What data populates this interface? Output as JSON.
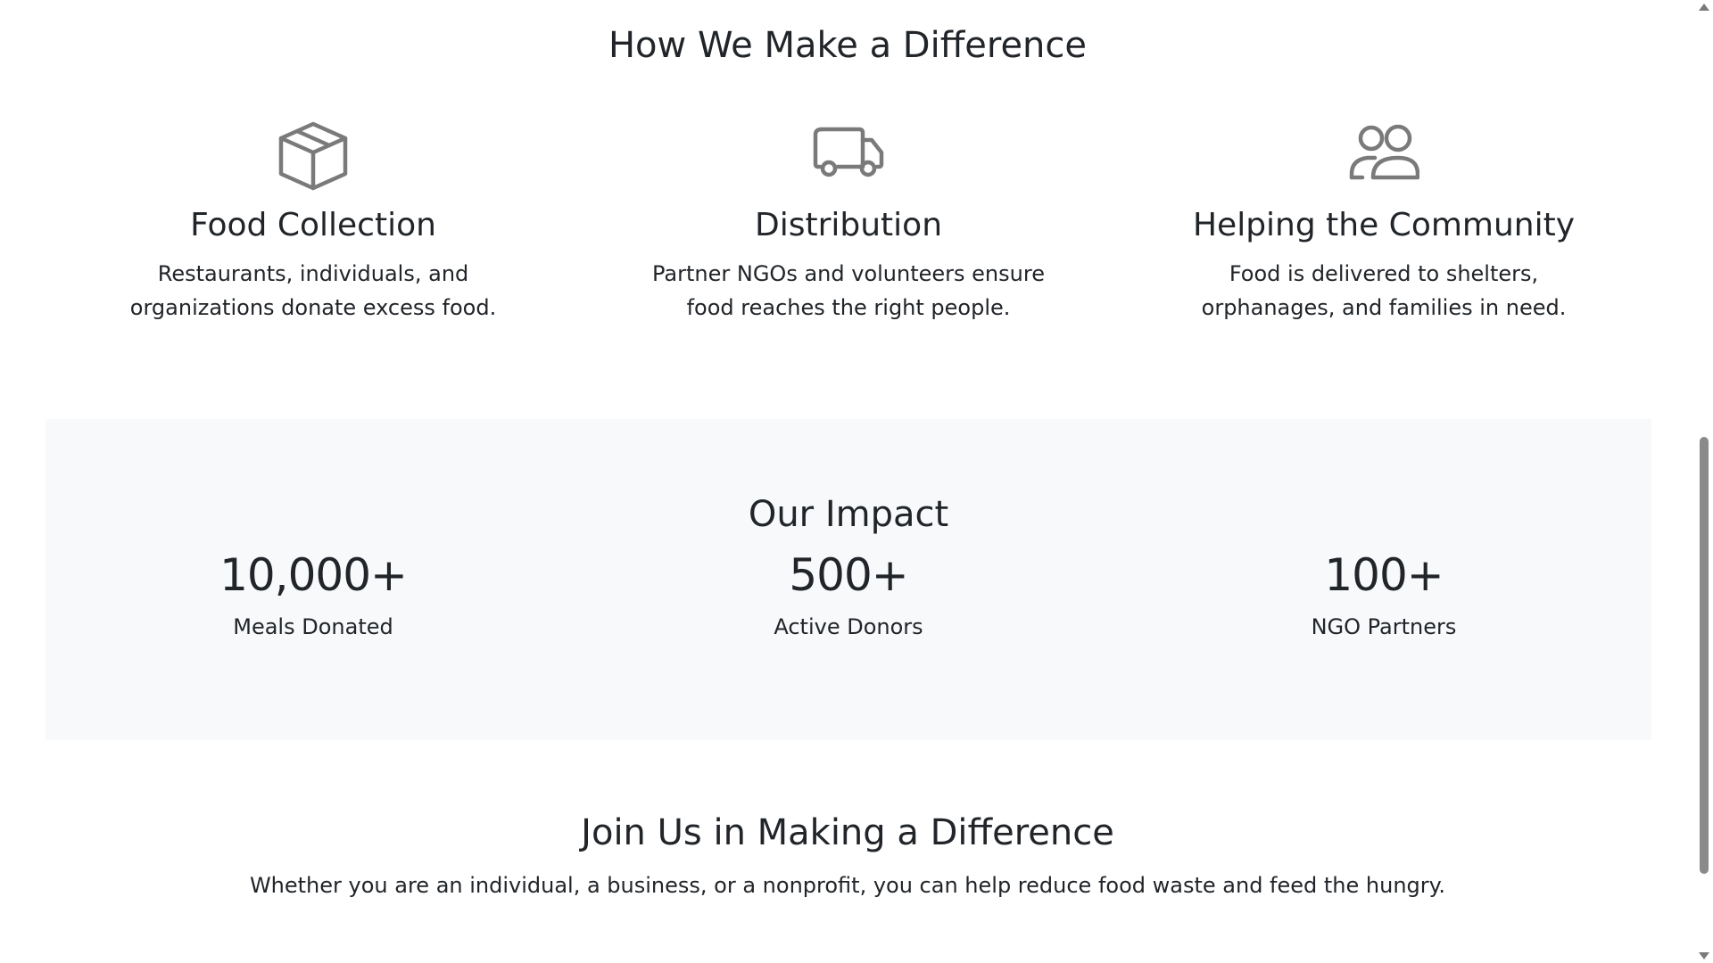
{
  "how_section": {
    "title": "How We Make a Difference",
    "features": [
      {
        "icon": "box-icon",
        "title": "Food Collection",
        "description": "Restaurants, individuals, and organizations donate excess food."
      },
      {
        "icon": "truck-icon",
        "title": "Distribution",
        "description": "Partner NGOs and volunteers ensure food reaches the right people."
      },
      {
        "icon": "people-icon",
        "title": "Helping the Community",
        "description": "Food is delivered to shelters, orphanages, and families in need."
      }
    ]
  },
  "impact_section": {
    "title": "Our Impact",
    "stats": [
      {
        "value": "10,000+",
        "label": "Meals Donated"
      },
      {
        "value": "500+",
        "label": "Active Donors"
      },
      {
        "value": "100+",
        "label": "NGO Partners"
      }
    ]
  },
  "join_section": {
    "title": "Join Us in Making a Difference",
    "text": "Whether you are an individual, a business, or a nonprofit, you can help reduce food waste and feed the hungry."
  },
  "colors": {
    "icon": "#7a7a7a",
    "text": "#212529",
    "impact_background": "#f8f9fa"
  }
}
